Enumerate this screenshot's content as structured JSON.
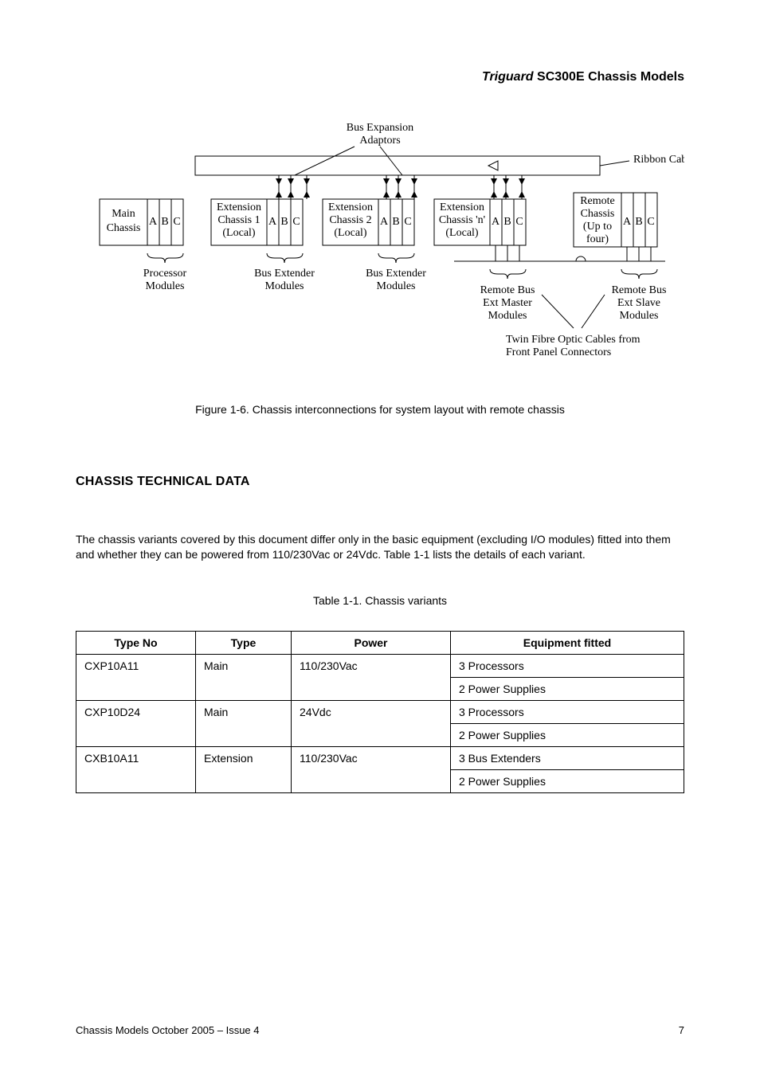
{
  "header": {
    "product_italic": "Triguard",
    "product_rest": " SC300E Chassis Models"
  },
  "diagram": {
    "bus_adaptors": "Bus Expansion",
    "bus_adaptors2": "Adaptors",
    "ribbon": "Ribbon Cables",
    "main_l1": "Main",
    "main_l2": "Chassis",
    "ext1_l1": "Extension",
    "ext1_l2": "Chassis 1",
    "ext1_l3": "(Local)",
    "ext2_l1": "Extension",
    "ext2_l2": "Chassis 2",
    "ext2_l3": "(Local)",
    "extn_l1": "Extension",
    "extn_l2": "Chassis 'n'",
    "extn_l3": "(Local)",
    "remote_l1": "Remote",
    "remote_l2": "Chassis",
    "remote_l3": "(Up to",
    "remote_l4": "four)",
    "A": "A",
    "B": "B",
    "C": "C",
    "processor_l1": "Processor",
    "processor_l2": "Modules",
    "busext_l1": "Bus Extender",
    "busext_l2": "Modules",
    "rem_master_l1": "Remote Bus",
    "rem_master_l2": "Ext Master",
    "rem_master_l3": "Modules",
    "rem_slave_l1": "Remote Bus",
    "rem_slave_l2": "Ext Slave",
    "rem_slave_l3": "Modules",
    "twin_l1": "Twin Fibre Optic Cables from",
    "twin_l2": "Front Panel Connectors"
  },
  "figure_caption": "Figure 1-6. Chassis interconnections for system layout with remote chassis",
  "section_heading": "CHASSIS TECHNICAL DATA",
  "body_text": "The chassis variants covered by this document differ only in the basic equipment (excluding I/O modules) fitted into them and whether they can be powered from 110/230Vac or 24Vdc. Table 1-1 lists the details of each variant.",
  "table_caption": "Table 1-1. Chassis variants",
  "table": {
    "headers": [
      "Type No",
      "Type",
      "Power",
      "Equipment fitted"
    ],
    "rows": [
      {
        "type_no": "CXP10A11",
        "type": "Main",
        "power": "110/230Vac",
        "equip1": "3 Processors",
        "equip2": "2 Power Supplies"
      },
      {
        "type_no": "CXP10D24",
        "type": "Main",
        "power": "24Vdc",
        "equip1": "3 Processors",
        "equip2": "2 Power Supplies"
      },
      {
        "type_no": "CXB10A11",
        "type": "Extension",
        "power": "110/230Vac",
        "equip1": "3 Bus Extenders",
        "equip2": "2 Power Supplies"
      }
    ]
  },
  "footer": {
    "left": "Chassis Models October 2005 –  Issue 4",
    "right": "7"
  },
  "chart_data": [
    {
      "type": "table",
      "title": "Table 1-1. Chassis variants",
      "columns": [
        "Type No",
        "Type",
        "Power",
        "Equipment fitted"
      ],
      "rows": [
        [
          "CXP10A11",
          "Main",
          "110/230Vac",
          "3 Processors; 2 Power Supplies"
        ],
        [
          "CXP10D24",
          "Main",
          "24Vdc",
          "3 Processors; 2 Power Supplies"
        ],
        [
          "CXB10A11",
          "Extension",
          "110/230Vac",
          "3 Bus Extenders; 2 Power Supplies"
        ]
      ]
    }
  ]
}
